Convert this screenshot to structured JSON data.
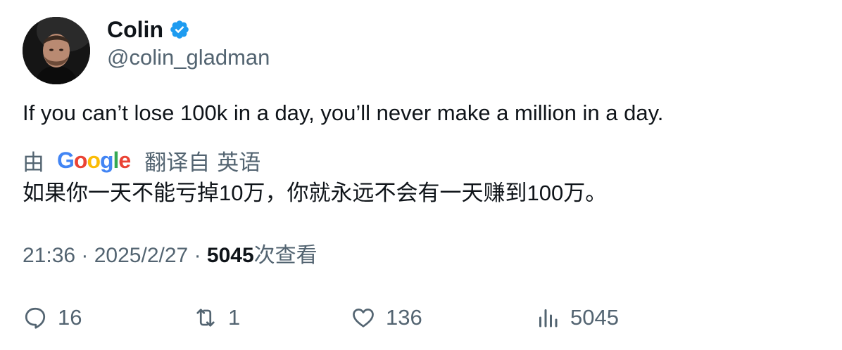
{
  "author": {
    "display_name": "Colin",
    "handle": "@colin_gladman",
    "verified": true,
    "verified_color": "#1d9bf0"
  },
  "tweet": {
    "text": "If you can’t lose 100k in a day, you’ll never make a million in a day."
  },
  "translation": {
    "by_label": "由",
    "provider_logo": "Google",
    "from_label": "翻译自",
    "language": "英语",
    "text": "如果你一天不能亏掉10万，你就永远不会有一天赚到100万。"
  },
  "meta": {
    "time": "21:36",
    "separator": "·",
    "date": "2025/2/27",
    "views_count": "5045",
    "views_label": "次查看"
  },
  "actions": {
    "reply": {
      "icon": "reply-icon",
      "count": "16"
    },
    "retweet": {
      "icon": "retweet-icon",
      "count": "1"
    },
    "like": {
      "icon": "heart-icon",
      "count": "136"
    },
    "views": {
      "icon": "analytics-icon",
      "count": "5045"
    }
  },
  "colors": {
    "text_primary": "#0f1419",
    "text_secondary": "#536471"
  }
}
